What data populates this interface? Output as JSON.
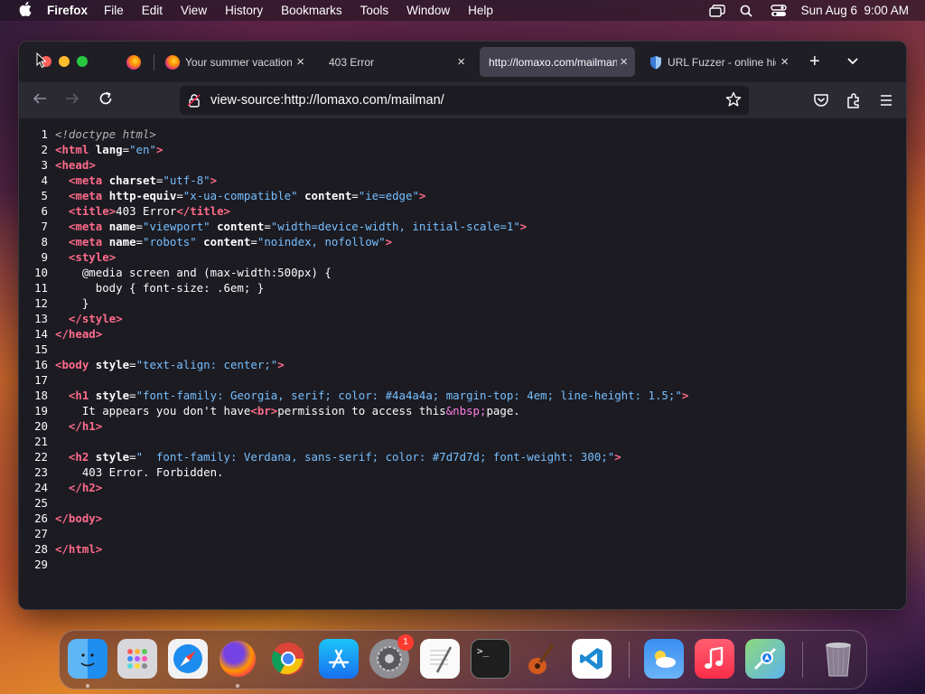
{
  "menubar": {
    "app_name": "Firefox",
    "items": [
      "File",
      "Edit",
      "View",
      "History",
      "Bookmarks",
      "Tools",
      "Window",
      "Help"
    ],
    "clock": "Sun Aug 6  9:00 AM"
  },
  "tabs": [
    {
      "label": "Your summer vacation"
    },
    {
      "label": "403 Error"
    },
    {
      "label": "http://lomaxo.com/mailman/"
    },
    {
      "label": "URL Fuzzer - online hidden"
    }
  ],
  "urlbar": {
    "value": "view-source:http://lomaxo.com/mailman/"
  },
  "source_lines": [
    {
      "n": "1"
    },
    {
      "n": "2"
    },
    {
      "n": "3"
    },
    {
      "n": "4"
    },
    {
      "n": "5"
    },
    {
      "n": "6"
    },
    {
      "n": "7"
    },
    {
      "n": "8"
    },
    {
      "n": "9"
    },
    {
      "n": "10"
    },
    {
      "n": "11"
    },
    {
      "n": "12"
    },
    {
      "n": "13"
    },
    {
      "n": "14"
    },
    {
      "n": "15"
    },
    {
      "n": "16"
    },
    {
      "n": "17"
    },
    {
      "n": "18"
    },
    {
      "n": "19"
    },
    {
      "n": "20"
    },
    {
      "n": "21"
    },
    {
      "n": "22"
    },
    {
      "n": "23"
    },
    {
      "n": "24"
    },
    {
      "n": "25"
    },
    {
      "n": "26"
    },
    {
      "n": "27"
    },
    {
      "n": "28"
    },
    {
      "n": "29"
    }
  ],
  "source": {
    "l1": "<!doctype html>",
    "l2_tag": "html",
    "l2_attr": "lang",
    "l2_val": "\"en\"",
    "l3_tag": "head",
    "l4_tag": "meta",
    "l4_attr": "charset",
    "l4_val": "\"utf-8\"",
    "l5_tag": "meta",
    "l5_attr1": "http-equiv",
    "l5_val1": "\"x-ua-compatible\"",
    "l5_attr2": "content",
    "l5_val2": "\"ie=edge\"",
    "l6_tag": "title",
    "l6_text": "403 Error",
    "l6_close": "title",
    "l7_tag": "meta",
    "l7_attr1": "name",
    "l7_val1": "\"viewport\"",
    "l7_attr2": "content",
    "l7_val2": "\"width=device-width, initial-scale=1\"",
    "l8_tag": "meta",
    "l8_attr1": "name",
    "l8_val1": "\"robots\"",
    "l8_attr2": "content",
    "l8_val2": "\"noindex, nofollow\"",
    "l9_tag": "style",
    "l10": "    @media screen and (max-width:500px) {",
    "l11": "      body { font-size: .6em; }",
    "l12": "    }",
    "l13_tag": "style",
    "l14_tag": "head",
    "l16_tag": "body",
    "l16_attr": "style",
    "l16_val": "\"text-align: center;\"",
    "l18_tag": "h1",
    "l18_attr": "style",
    "l18_val": "\"font-family: Georgia, serif; color: #4a4a4a; margin-top: 4em; line-height: 1.5;\"",
    "l19_a": "    It appears you don't have",
    "l19_br": "br",
    "l19_b": "permission to access this",
    "l19_ent": "&nbsp;",
    "l19_c": "page.",
    "l20_tag": "h1",
    "l22_tag": "h2",
    "l22_attr": "style",
    "l22_val": "\"  font-family: Verdana, sans-serif; color: #7d7d7d; font-weight: 300;\"",
    "l23": "    403 Error. Forbidden.",
    "l24_tag": "h2",
    "l26_tag": "body",
    "l28_tag": "html"
  },
  "dock": {
    "settings_badge": "1"
  }
}
